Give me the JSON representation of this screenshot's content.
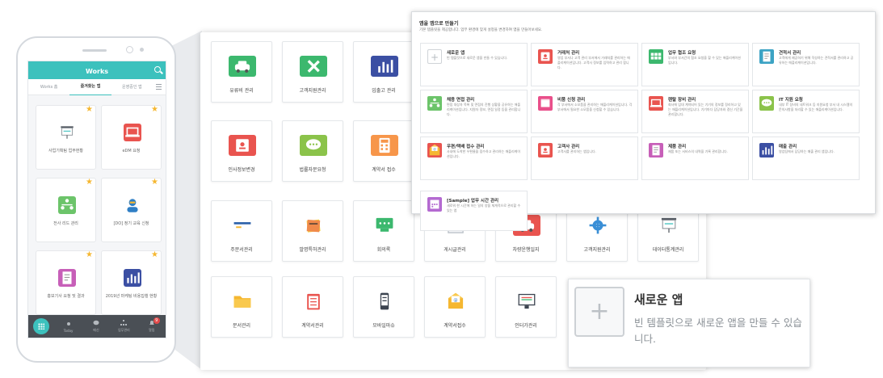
{
  "mobile": {
    "app_title": "Works",
    "tabs": [
      "Works 홈",
      "즐겨찾는 앱",
      "운영중인 앱"
    ],
    "cards": [
      {
        "label": "사업기획팀 업무현황",
        "color": "#ffffff",
        "icon": "projector-screen-icon"
      },
      {
        "label": "eDM 요청",
        "color": "#e9544f",
        "icon": "laptop-icon"
      },
      {
        "label": "전사 리드 관리",
        "color": "#6cc46a",
        "icon": "org-chart-icon"
      },
      {
        "label": "[DO] 정기 교육 신청",
        "color": "#2f7fc5",
        "icon": "person-icon"
      },
      {
        "label": "홍보기사 요청 및 결과",
        "color": "#c75fb8",
        "icon": "document-icon"
      },
      {
        "label": "2019년 마케팅 비용집행 현황",
        "color": "#3b4fa3",
        "icon": "bar-chart-icon"
      }
    ],
    "bottom_tabs": [
      "Today",
      "메신",
      "업무관리",
      "알림"
    ],
    "badge": "9"
  },
  "board": {
    "apps": [
      {
        "label": "유류비 관리",
        "color": "#3cb86e",
        "icon": "car-icon"
      },
      {
        "label": "고객지원관리",
        "color": "#3cb86e",
        "icon": "tools-icon"
      },
      {
        "label": "입출고 관리",
        "color": "#3b4fa3",
        "icon": "bar-chart-icon"
      },
      {
        "label": "인사정보변경",
        "color": "#e9544f",
        "icon": "id-card-icon"
      },
      {
        "label": "법률자문요청",
        "color": "#8bc34a",
        "icon": "chat-bubble-icon"
      },
      {
        "label": "계약서 접수",
        "color": "#f7964a",
        "icon": "calculator-icon"
      },
      {
        "label": "주문서관리",
        "color": "#3a7ed0",
        "icon": "credit-card-icon"
      },
      {
        "label": "발명특허관리",
        "color": "#f0a23a",
        "icon": "sticky-notes-icon"
      },
      {
        "label": "회의록",
        "color": "#3cb86e",
        "icon": "meeting-icon"
      },
      {
        "label": "게시글관리",
        "color": "#b8bfc6",
        "icon": "newspaper-icon"
      },
      {
        "label": "차량운행일지",
        "color": "#e9544f",
        "icon": "car-icon"
      },
      {
        "label": "고객지원관리",
        "color": "#3a8fd6",
        "icon": "gear-icon"
      },
      {
        "label": "데이터통계관리",
        "color": "#ffffff",
        "icon": "projector-screen-icon"
      },
      {
        "label": "문서관리",
        "color": "#f5b731",
        "icon": "folder-icon"
      },
      {
        "label": "계약서관리",
        "color": "#e9544f",
        "icon": "clipboard-icon"
      },
      {
        "label": "모바일마슈",
        "color": "#3c4450",
        "icon": "mobile-icon"
      },
      {
        "label": "계약서접수",
        "color": "#f5b731",
        "icon": "mail-icon"
      },
      {
        "label": "인터가관리",
        "color": "#3c4450",
        "icon": "monitor-icon"
      }
    ]
  },
  "panel": {
    "title": "앱을 앱으로 만들기",
    "subtitle": "기본 템플릿을 제공합니다. 업무 환경에 맞게 설정을 변경하여 앱을 만들어보세요.",
    "cards": [
      {
        "title": "새로운 앱",
        "desc": "빈 템플릿으로 새로운 앱을 만들 수 있습니다.",
        "color": "#ffffff",
        "icon": "plus-icon"
      },
      {
        "title": "거래처 관리",
        "desc": "영업 부서나 고객 관리 부서에서 거래처를 관리하는 애플리케이션입니다. 고객사 정보를 입력하고 관리 합니다.",
        "color": "#e9544f",
        "icon": "id-card-icon"
      },
      {
        "title": "업무 협조 요청",
        "desc": "부서와 부서간의 협조 요청을 할 수 있는 애플리케이션입니다.",
        "color": "#3cb86e",
        "icon": "grid-icon"
      },
      {
        "title": "견적서 관리",
        "desc": "고객에게 제공하기 위해 작성하는 견적서를 관리하고 공유하는 애플리케이션입니다.",
        "color": "#3ca3c4",
        "icon": "document-icon"
      },
      {
        "title": "채용 면접 관리",
        "desc": "면접 대상자 목록 및 면접의 진행 상황을 공유하는 애플리케이션입니다. 지원자 정보, 면접 일정 등을 관리합니다.",
        "color": "#6cc46a",
        "icon": "org-chart-icon"
      },
      {
        "title": "비품 신청 관리",
        "desc": "각 부서에서 소모품을 관리하는 애플리케이션입니다. 각 부서에서 필요한 소모품을 신청할 수 있습니다.",
        "color": "#e94f8a",
        "icon": "box-icon"
      },
      {
        "title": "렌탈 장비 관리",
        "desc": "회사에 임대 계약되어 있는 기기의 정보를 정리하고 있는 애플리케이션입니다. 기기마다 담당자와 갱신 기간을 관리합니다.",
        "color": "#e9544f",
        "icon": "laptop-icon"
      },
      {
        "title": "IT 지원 요청",
        "desc": "내부 IT 장비의 네트워크 등 지원요청 부서 내 시스템의 문의사항을 처리할 수 있는 애플리케이션입니다.",
        "color": "#8bc34a",
        "icon": "chat-bubble-icon"
      },
      {
        "title": "우편/택배 접수 관리",
        "desc": "사내에 도착한 우편물을 접수하고 관리하는 애플리케이션입니다.",
        "color": "#e9544f",
        "icon": "mail-icon"
      },
      {
        "title": "고객사 관리",
        "desc": "고객사를 관리하는 앱입니다.",
        "color": "#e9544f",
        "icon": "id-card-icon"
      },
      {
        "title": "제품 관리",
        "desc": "제품 또는 서비스의 내역을 기록 관리합니다.",
        "color": "#c75fb8",
        "icon": "document-icon"
      },
      {
        "title": "매출 관리",
        "desc": "영업팀에서 담당하는 매출 관리 앱입니다.",
        "color": "#3b4fa3",
        "icon": "bar-chart-icon"
      },
      {
        "title": "[Sample] 업무 시간 관리",
        "desc": "새로워 한 시간에 하는 일의 양을 체계적으로 관리할 수 있는 앱",
        "color": "#b46ad1",
        "icon": "calendar-icon"
      }
    ]
  },
  "zoom": {
    "title": "새로운 앱",
    "desc": "빈 템플릿으로 새로운 앱을 만들 수 있습니다."
  }
}
